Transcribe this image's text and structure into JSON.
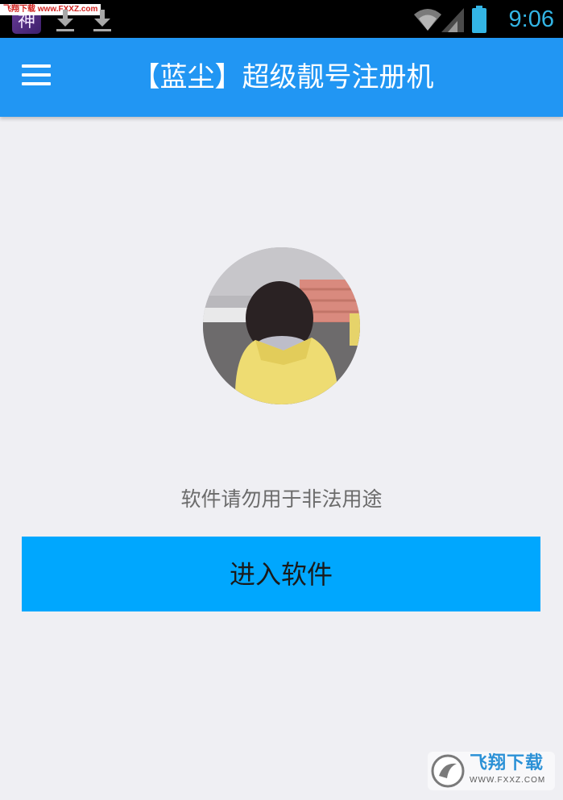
{
  "status_bar": {
    "time": "9:06",
    "app_icon_glyph": "神",
    "site_watermark": "飞翔下载 www.FXXZ.com",
    "icons": [
      "app-icon",
      "download-icon",
      "download-icon",
      "wifi-icon",
      "signal-icon",
      "battery-icon"
    ]
  },
  "app_bar": {
    "title": "【蓝尘】超级靓号注册机",
    "menu_icon": "hamburger-menu-icon"
  },
  "main": {
    "avatar": "profile-photo",
    "disclaimer": "软件请勿用于非法用途",
    "enter_button": "进入软件"
  },
  "watermark": {
    "title": "飞翔下载",
    "url": "WWW.FXXZ.COM"
  },
  "colors": {
    "status_bar": "#000000",
    "app_bar": "#2196f3",
    "background": "#efeff3",
    "button": "#00a7fe",
    "clock": "#33b5e5"
  }
}
